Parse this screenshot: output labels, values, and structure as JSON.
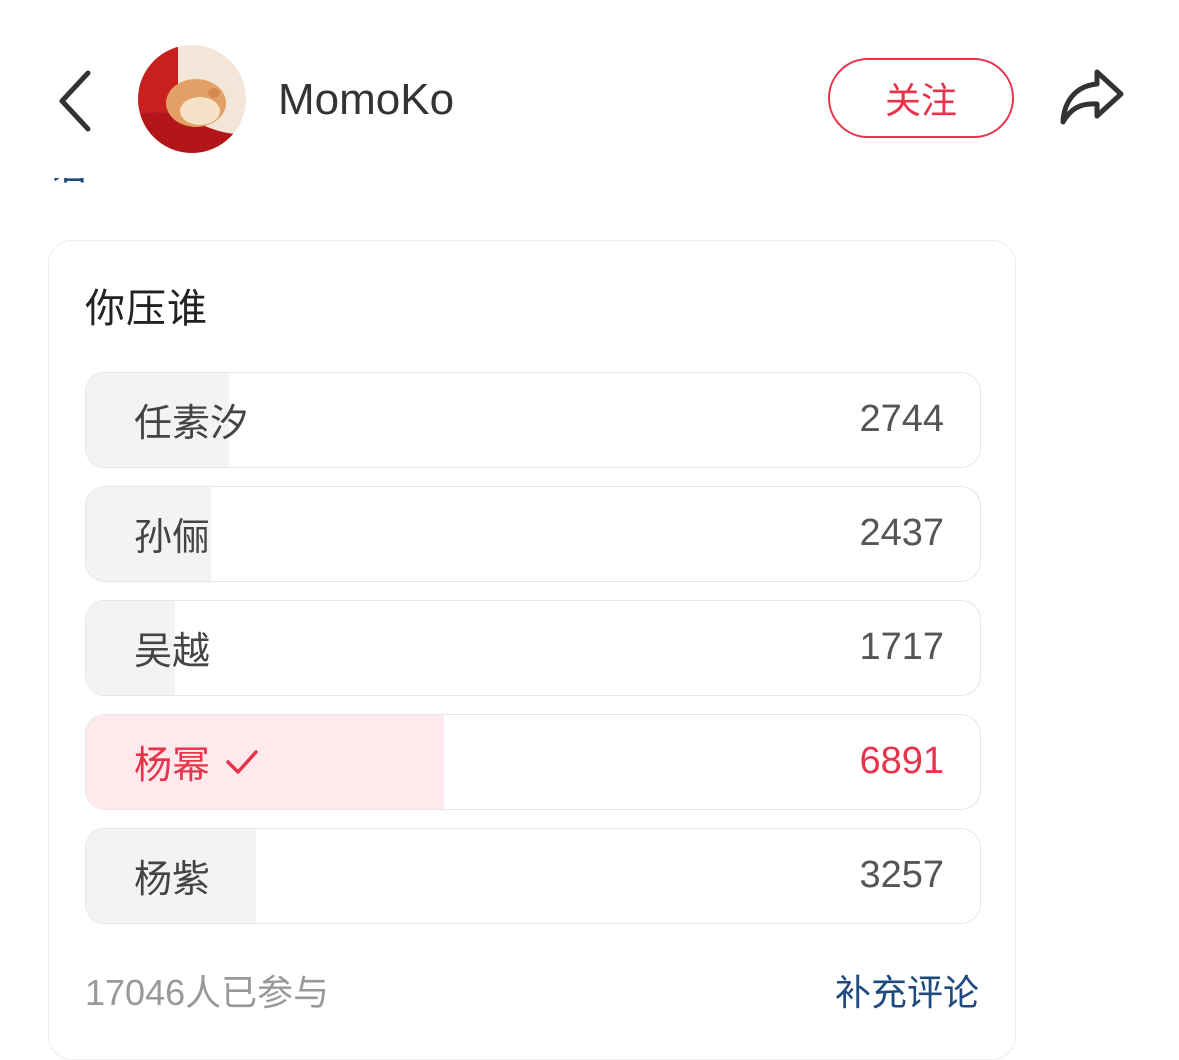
{
  "header": {
    "username": "MomoKo",
    "follow_label": "关注"
  },
  "cut_text": "语",
  "poll": {
    "title": "你压谁",
    "options": [
      {
        "name": "任素汐",
        "count": "2744",
        "fill_fraction": 0.16,
        "selected": false
      },
      {
        "name": "孙俪",
        "count": "2437",
        "fill_fraction": 0.14,
        "selected": false
      },
      {
        "name": "吴越",
        "count": "1717",
        "fill_fraction": 0.1,
        "selected": false
      },
      {
        "name": "杨幂",
        "count": "6891",
        "fill_fraction": 0.4,
        "selected": true
      },
      {
        "name": "杨紫",
        "count": "3257",
        "fill_fraction": 0.19,
        "selected": false
      }
    ],
    "participants": "17046人已参与",
    "add_comment_label": "补充评论"
  },
  "colors": {
    "accent": "#e8334a",
    "link": "#1f4a7d",
    "option_fill": "#f3f3f5",
    "selected_fill": "#ffe9ec"
  },
  "icons": {
    "back": "chevron-left-icon",
    "share": "share-arrow-icon",
    "check": "check-icon"
  }
}
